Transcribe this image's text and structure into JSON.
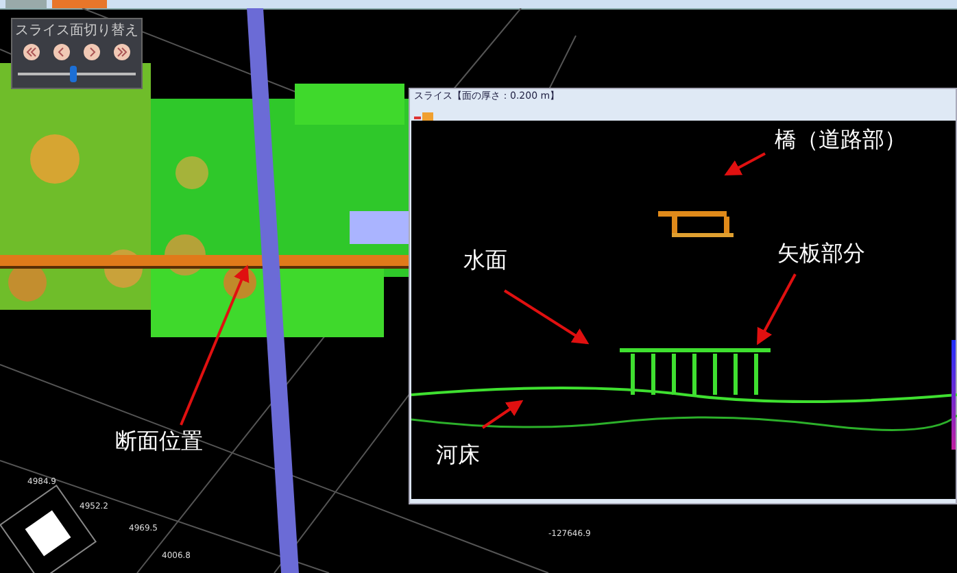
{
  "top_bar": {
    "tabs": [
      {
        "selected": false
      },
      {
        "selected": true
      }
    ]
  },
  "slice_switch_panel": {
    "title": "スライス面切り替え",
    "slider": {
      "level": 0.47
    }
  },
  "view_annotations": [
    {
      "label": "断面位置"
    }
  ],
  "coordinate_labels": [
    "4984.9",
    "4952.2",
    "4969.5",
    "4006.8",
    "-127646.9"
  ],
  "slice_window": {
    "title": "スライス【面の厚さ：0.200 m】",
    "annotations": [
      {
        "label": "橋（道路部）"
      },
      {
        "label": "矢板部分"
      },
      {
        "label": "水面"
      },
      {
        "label": "河床"
      }
    ]
  }
}
